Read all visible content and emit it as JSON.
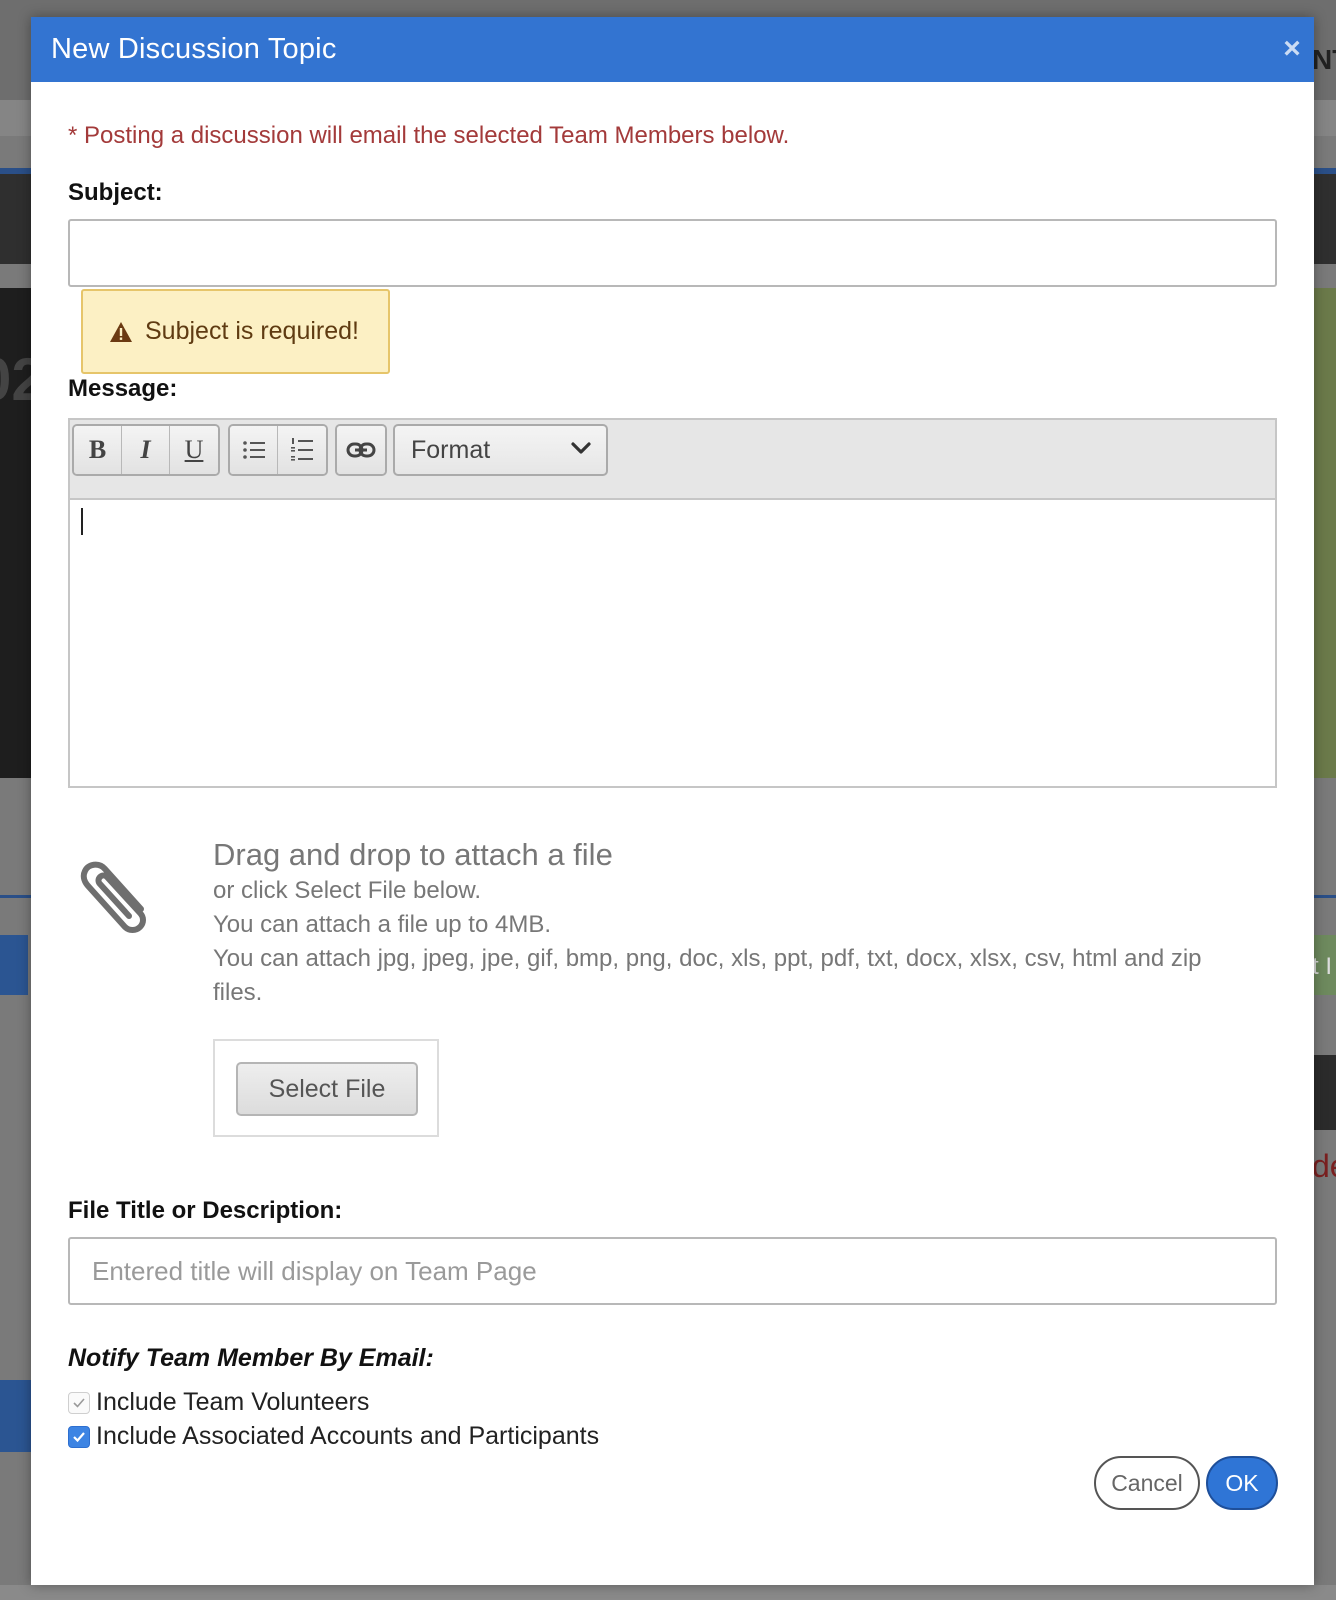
{
  "modal": {
    "title": "New Discussion Topic",
    "close_glyph": "×",
    "notice": "* Posting a discussion will email the selected Team Members below.",
    "subject": {
      "label": "Subject:",
      "value": "",
      "error": "Subject is required!"
    },
    "message": {
      "label": "Message:",
      "toolbar": {
        "bold": "B",
        "italic": "I",
        "underline": "U",
        "format": "Format"
      },
      "content": ""
    },
    "attachment": {
      "title": "Drag and drop to attach a file",
      "line1": "or click Select File below.",
      "line2": "You can attach a file up to 4MB.",
      "line3": "You can attach jpg, jpeg, jpe, gif, bmp, png, doc, xls, ppt, pdf, txt, docx, xlsx, csv, html and zip",
      "line4": "files.",
      "button": "Select File"
    },
    "file_title": {
      "label": "File Title or Description:",
      "placeholder": "Entered title will display on Team Page",
      "value": ""
    },
    "notify": {
      "title": "Notify Team Member By Email:",
      "options": [
        {
          "label": "Include Team Volunteers",
          "checked": true,
          "disabled": true
        },
        {
          "label": "Include Associated Accounts and Participants",
          "checked": true,
          "disabled": false
        }
      ]
    },
    "buttons": {
      "cancel": "Cancel",
      "ok": "OK"
    }
  },
  "background": {
    "edge_text_top": "NT",
    "edge_text_mid": "t I",
    "edge_text_red": "de",
    "edge_text_left": "02"
  },
  "colors": {
    "header": "#3374d1",
    "notice": "#a33a3a",
    "warning_bg": "#fcf0c4",
    "primary": "#2f75d6"
  }
}
